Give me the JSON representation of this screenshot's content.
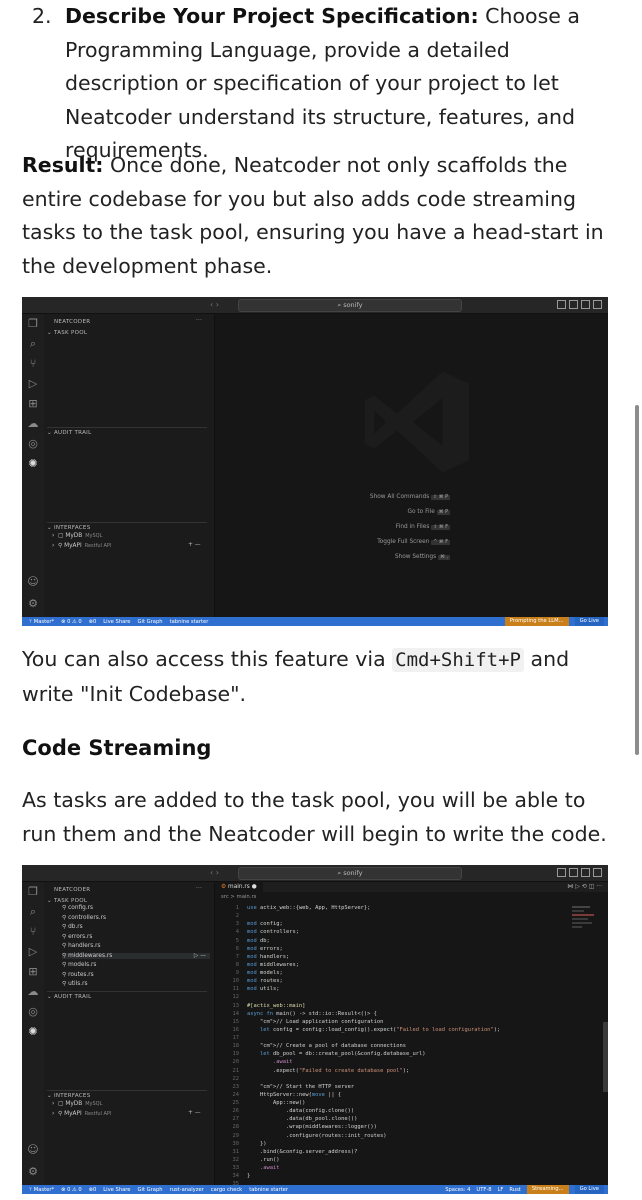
{
  "step2": {
    "number": "2.",
    "title": "Describe Your Project Specification:",
    "text": " Choose a Programming Language, provide a detailed description or specification of your project to let Neatcoder understand its structure, features, and requirements."
  },
  "result": {
    "label": "Result:",
    "text": " Once done, Neatcoder not only scaffolds the entire codebase for you but also adds code streaming tasks to the task pool, ensuring you have a head-start in the development phase."
  },
  "access": {
    "before": "You can also access this feature via ",
    "shortcut": "Cmd+Shift+P",
    "after": " and write \"Init Codebase\"."
  },
  "section_heading": "Code Streaming",
  "streaming_text": "As tasks are added to the task pool, you will be able to run them and the Neatcoder will begin to write the code.",
  "shot1": {
    "search": "⌕ sonify",
    "sidebar_title": "NEATCODER",
    "task_pool": "TASK POOL",
    "audit_trail": "AUDIT TRAIL",
    "interfaces": "INTERFACES",
    "db_name": "MyDB",
    "db_type": "MySQL",
    "api_name": "MyAPI",
    "api_type": "Restful API",
    "shortcuts": [
      {
        "label": "Show All Commands",
        "keys": "⇧ ⌘ P"
      },
      {
        "label": "Go to File",
        "keys": "⌘ P"
      },
      {
        "label": "Find in Files",
        "keys": "⇧ ⌘ F"
      },
      {
        "label": "Toggle Full Screen",
        "keys": "^ ⌘ F"
      },
      {
        "label": "Show Settings",
        "keys": "⌘ ,"
      }
    ],
    "status_left": [
      "ᛘ Master*",
      "⊗ 0 ⚠ 0",
      "⊗0",
      "Live Share",
      "Git Graph",
      "tabnine starter"
    ],
    "status_progress": "Prompting the LLM...",
    "status_live": "Go Live"
  },
  "shot2": {
    "search": "⌕ sonify",
    "sidebar_title": "NEATCODER",
    "task_pool": "TASK POOL",
    "audit_trail": "AUDIT TRAIL",
    "interfaces": "INTERFACES",
    "db_name": "MyDB",
    "db_type": "MySQL",
    "api_name": "MyAPI",
    "api_type": "Restful API",
    "tasks": [
      "config.rs",
      "controllers.rs",
      "db.rs",
      "errors.rs",
      "handlers.rs",
      "middlewares.rs",
      "models.rs",
      "routes.rs",
      "utils.rs"
    ],
    "tab": "main.rs",
    "breadcrumb": "src > main.rs",
    "code": [
      "use actix_web::{web, App, HttpServer};",
      "",
      "mod config;",
      "mod controllers;",
      "mod db;",
      "mod errors;",
      "mod handlers;",
      "mod middlewares;",
      "mod models;",
      "mod routes;",
      "mod utils;",
      "",
      "#[actix_web::main]",
      "async fn main() -> std::io::Result<()> {",
      "    // Load application configuration",
      "    let config = config::load_config().expect(\"Failed to load configuration\");",
      "",
      "    // Create a pool of database connections",
      "    let db_pool = db::create_pool(&config.database_url)",
      "        .await",
      "        .expect(\"Failed to create database pool\");",
      "",
      "    // Start the HTTP server",
      "    HttpServer::new(move || {",
      "        App::new()",
      "            .data(config.clone())",
      "            .data(db_pool.clone())",
      "            .wrap(middlewares::logger())",
      "            .configure(routes::init_routes)",
      "    })",
      "    .bind(&config.server_address)?",
      "    .run()",
      "    .await",
      "}",
      ""
    ],
    "status_left": [
      "ᛘ Master*",
      "⊗ 0 ⚠ 0",
      "⊗0",
      "Live Share",
      "Git Graph",
      "rust-analyzer",
      "cargo check",
      "tabnine starter"
    ],
    "status_right": [
      "Spaces: 4",
      "UTF-8",
      "LF",
      "Rust"
    ],
    "status_progress": "Streaming...",
    "status_live": "Go Live"
  }
}
